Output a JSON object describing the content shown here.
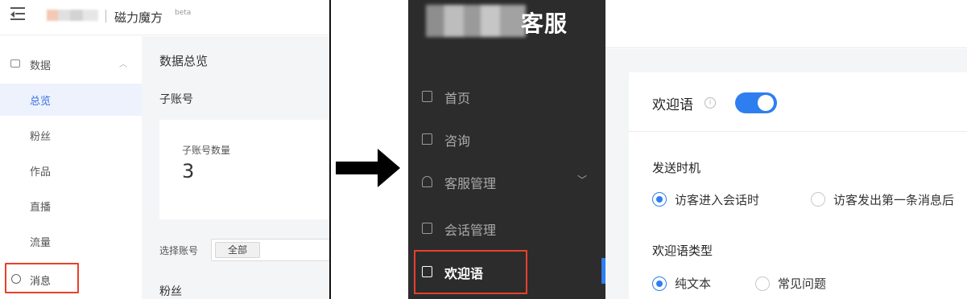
{
  "left_app": {
    "brand": "磁力魔方",
    "beta_tag": "beta",
    "nav": {
      "group_label": "数据",
      "items": [
        "总览",
        "粉丝",
        "作品",
        "直播",
        "流量"
      ],
      "active_index": 0,
      "message_label": "消息"
    },
    "main": {
      "title": "数据总览",
      "sub_account_heading": "子账号",
      "sub_account_count_label": "子账号数量",
      "sub_account_count": "3",
      "select_label": "选择账号",
      "select_value": "全部",
      "fans_heading": "粉丝"
    }
  },
  "right_app": {
    "title": "客服",
    "nav": [
      {
        "label": "首页",
        "icon": "home-icon"
      },
      {
        "label": "咨询",
        "icon": "chat-icon"
      },
      {
        "label": "客服管理",
        "icon": "agents-icon",
        "expandable": true
      },
      {
        "label": "会话管理",
        "icon": "sessions-icon"
      },
      {
        "label": "欢迎语",
        "icon": "welcome-icon",
        "active": true
      }
    ],
    "settings": {
      "title": "欢迎语",
      "info_glyph": "i",
      "enabled": true,
      "send_timing": {
        "label": "发送时机",
        "options": [
          "访客进入会话时",
          "访客发出第一条消息后"
        ],
        "selected_index": 0
      },
      "welcome_type": {
        "label": "欢迎语类型",
        "options": [
          "纯文本",
          "常见问题"
        ],
        "selected_index": 0
      }
    }
  },
  "colors": {
    "highlight_red": "#e8402a",
    "accent_blue": "#2e7ef0",
    "dark_sidebar": "#2c2c2c",
    "active_nav_bg": "#edf2fd"
  }
}
